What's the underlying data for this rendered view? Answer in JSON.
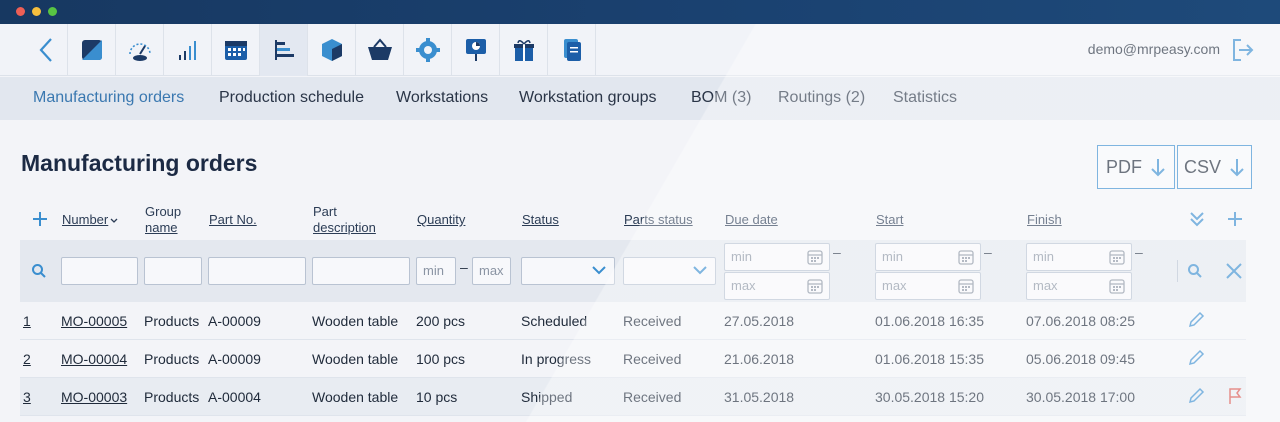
{
  "window": {
    "controls": [
      "close",
      "minimize",
      "zoom"
    ]
  },
  "toolbar": {
    "icons": [
      "back-icon",
      "dashboard-icon",
      "speedometer-icon",
      "signal-bars-icon",
      "calendar-icon",
      "gantt-icon",
      "cube-icon",
      "basket-icon",
      "gear-icon",
      "presentation-icon",
      "gift-icon",
      "documents-icon"
    ],
    "user_email": "demo@mrpeasy.com",
    "logout_icon": "logout-icon"
  },
  "subnav": {
    "items": [
      {
        "label": "Manufacturing orders",
        "active": true
      },
      {
        "label": "Production schedule"
      },
      {
        "label": "Workstations"
      },
      {
        "label": "Workstation groups"
      },
      {
        "label": "BOM (3)"
      },
      {
        "label": "Routings (2)"
      },
      {
        "label": "Statistics"
      }
    ]
  },
  "main": {
    "title": "Manufacturing orders",
    "export_pdf": "PDF",
    "export_csv": "CSV"
  },
  "table": {
    "headers": {
      "number": "Number",
      "group_name_1": "Group",
      "group_name_2": "name",
      "part_no": "Part No.",
      "part_desc_1": "Part",
      "part_desc_2": "description",
      "quantity": "Quantity",
      "status": "Status",
      "parts_status": "Parts status",
      "due_date": "Due date",
      "start": "Start",
      "finish": "Finish"
    },
    "filters": {
      "min": "min",
      "max": "max",
      "dash": "–"
    },
    "rows": [
      {
        "idx": "1",
        "number": "MO-00005",
        "group": "Products",
        "part_no": "A-00009",
        "desc": "Wooden table",
        "qty": "200 pcs",
        "status": "Scheduled",
        "parts_status": "Received",
        "due": "27.05.2018",
        "start": "01.06.2018 16:35",
        "finish": "07.06.2018 08:25",
        "flag": false
      },
      {
        "idx": "2",
        "number": "MO-00004",
        "group": "Products",
        "part_no": "A-00009",
        "desc": "Wooden table",
        "qty": "100 pcs",
        "status": "In progress",
        "parts_status": "Received",
        "due": "21.06.2018",
        "start": "01.06.2018 15:35",
        "finish": "05.06.2018 09:45",
        "flag": false
      },
      {
        "idx": "3",
        "number": "MO-00003",
        "group": "Products",
        "part_no": "A-00004",
        "desc": "Wooden table",
        "qty": "10 pcs",
        "status": "Shipped",
        "parts_status": "Received",
        "due": "31.05.2018",
        "start": "30.05.2018 15:20",
        "finish": "30.05.2018 17:00",
        "flag": true
      }
    ]
  },
  "colors": {
    "accent": "#3a8ecf",
    "titlebar": "#173861",
    "flag": "#d9534f"
  }
}
